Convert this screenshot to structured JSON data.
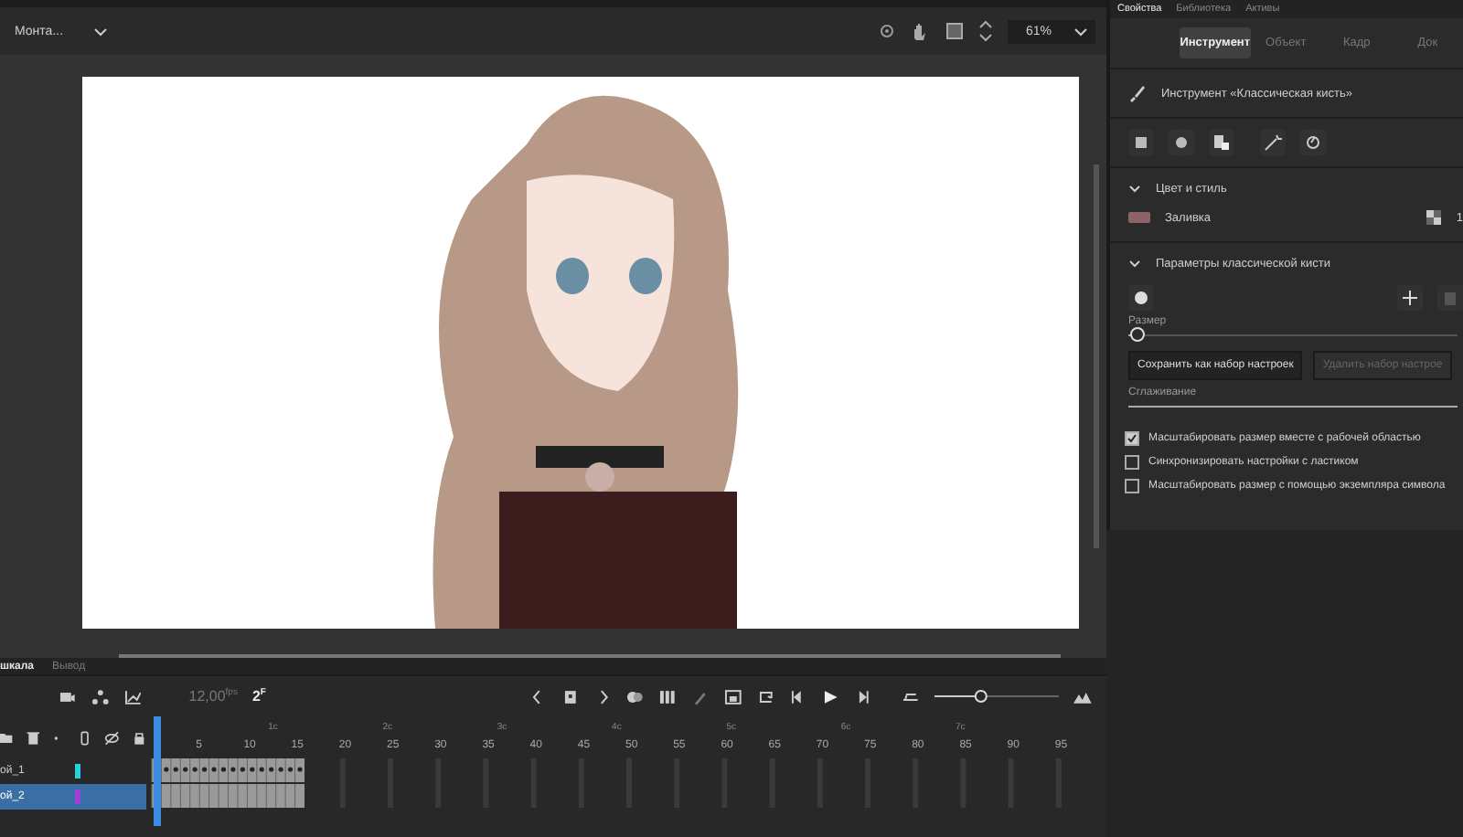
{
  "toolbar": {
    "workspace": "Монта...",
    "zoom": "61%"
  },
  "timeline": {
    "tabs": [
      {
        "label": "шкала",
        "selected": true
      },
      {
        "label": "Вывод",
        "selected": false
      }
    ],
    "zoom_slider": {
      "level": 0.35
    },
    "fps_value": "12,00",
    "fps_unit": "fps",
    "frame_value": "2",
    "frame_unit": "F",
    "seconds": [
      "1с",
      "2с",
      "3с",
      "4с",
      "5с",
      "6с",
      "7с"
    ],
    "frame_numbers": [
      "5",
      "10",
      "15",
      "20",
      "25",
      "30",
      "35",
      "40",
      "45",
      "50",
      "55",
      "60",
      "65",
      "70",
      "75",
      "80",
      "85",
      "90",
      "95"
    ],
    "layers": [
      {
        "name": "ой_1",
        "selected": false,
        "color": "#28d0dc"
      },
      {
        "name": "ой_2",
        "selected": true,
        "color": "#a040d8"
      }
    ]
  },
  "properties": {
    "tabs": [
      {
        "label": "Свойства",
        "selected": true
      },
      {
        "label": "Библиотека",
        "selected": false
      },
      {
        "label": "Активы",
        "selected": false
      }
    ],
    "subtabs": [
      {
        "label": "Инструмент",
        "selected": true
      },
      {
        "label": "Объект",
        "selected": false
      },
      {
        "label": "Кадр",
        "selected": false
      },
      {
        "label": "Док",
        "selected": false
      }
    ],
    "tool_name": "Инструмент «Классическая кисть»",
    "color_section": {
      "title": "Цвет и стиль",
      "expanded": true,
      "fill_label": "Заливка",
      "extra": "1"
    },
    "brush_section": {
      "title": "Параметры классической кисти",
      "expanded": true,
      "size_label": "Размер",
      "size": {
        "level": 0.03
      },
      "buttons": [
        {
          "label": "Сохранить как набор настроек",
          "disabled": false
        },
        {
          "label": "Удалить набор настрое",
          "disabled": true
        }
      ],
      "smoothing_label": "Сглаживание",
      "smoothing": {
        "level": 1
      },
      "options": [
        {
          "label": "Масштабировать размер вместе с рабочей областью",
          "checked": true
        },
        {
          "label": "Синхронизировать настройки с ластиком",
          "checked": false
        },
        {
          "label": "Масштабировать размер с помощью экземпляра символа",
          "checked": false
        }
      ]
    }
  }
}
